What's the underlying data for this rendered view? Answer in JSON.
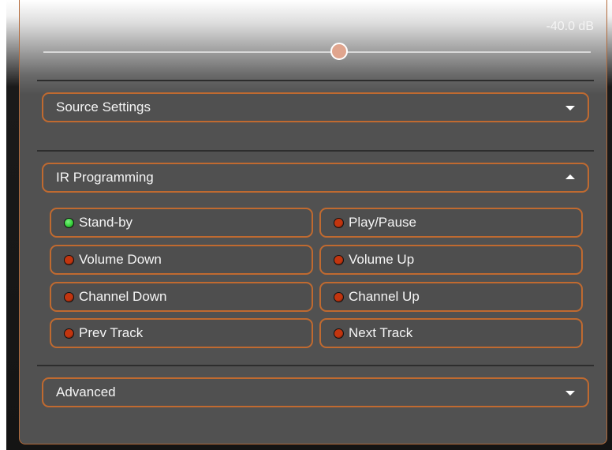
{
  "volume": {
    "readout": "-40.0 dB",
    "level_fraction": 0.54
  },
  "sections": {
    "source_settings": {
      "label": "Source Settings",
      "expanded": false,
      "caret_icon": "chevron-down-icon"
    },
    "ir_programming": {
      "label": "IR Programming",
      "expanded": true,
      "caret_icon": "chevron-up-icon"
    },
    "advanced": {
      "label": "Advanced",
      "expanded": false,
      "caret_icon": "chevron-down-icon"
    }
  },
  "ir_buttons": [
    {
      "label": "Stand-by",
      "led": "green"
    },
    {
      "label": "Play/Pause",
      "led": "red"
    },
    {
      "label": "Volume Down",
      "led": "red"
    },
    {
      "label": "Volume Up",
      "led": "red"
    },
    {
      "label": "Channel Down",
      "led": "red"
    },
    {
      "label": "Channel Up",
      "led": "red"
    },
    {
      "label": "Prev Track",
      "led": "red"
    },
    {
      "label": "Next Track",
      "led": "red"
    }
  ],
  "colors": {
    "accent_border": "#c06a30",
    "led_green": "#35d13a",
    "led_red": "#c2350f",
    "panel_bg": "#515151"
  }
}
